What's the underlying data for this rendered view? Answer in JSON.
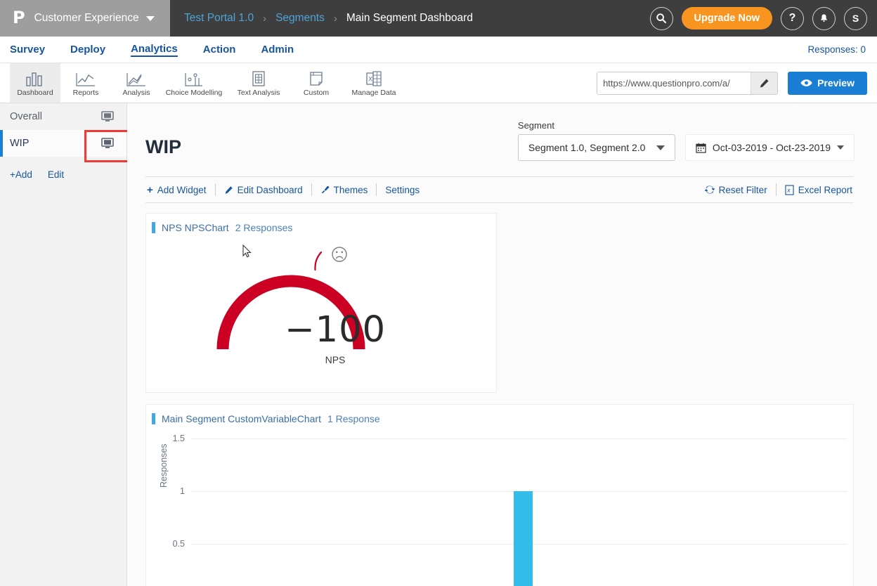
{
  "topbar": {
    "logo_glyph": "P",
    "brand_name": "Customer Experience",
    "breadcrumbs": [
      {
        "label": "Test Portal 1.0",
        "current": false
      },
      {
        "label": "Segments",
        "current": false
      },
      {
        "label": "Main Segment Dashboard",
        "current": true
      }
    ],
    "separator": "›",
    "search_icon": "⌕",
    "upgrade_label": "Upgrade Now",
    "help_icon": "?",
    "bell_icon": "▲",
    "avatar_label": "S"
  },
  "nav": {
    "tabs": [
      {
        "label": "Survey",
        "active": false
      },
      {
        "label": "Deploy",
        "active": false
      },
      {
        "label": "Analytics",
        "active": true
      },
      {
        "label": "Action",
        "active": false
      },
      {
        "label": "Admin",
        "active": false
      }
    ],
    "responses": "Responses: 0"
  },
  "icontoolbar": {
    "items": [
      {
        "label": "Dashboard",
        "icon": "bar-chart-icon",
        "active": true
      },
      {
        "label": "Reports",
        "icon": "line-chart-icon",
        "active": false
      },
      {
        "label": "Analysis",
        "icon": "trend-chart-icon",
        "active": false
      },
      {
        "label": "Choice Modelling",
        "icon": "scatter-chart-icon",
        "active": false
      },
      {
        "label": "Text Analysis",
        "icon": "document-grid-icon",
        "active": false
      },
      {
        "label": "Custom",
        "icon": "page-corner-icon",
        "active": false
      },
      {
        "label": "Manage Data",
        "icon": "excel-icon",
        "active": false
      }
    ],
    "url_value": "https://www.questionpro.com/a/",
    "url_placeholder": "https://www.questionpro.com/a/",
    "edit_icon": "✎",
    "preview_label": "Preview",
    "preview_icon": "eye-icon"
  },
  "sidebar": {
    "items": [
      {
        "label": "Overall",
        "icon": "monitor-icon",
        "selected": false
      },
      {
        "label": "WIP",
        "icon": "monitor-icon",
        "selected": true
      }
    ],
    "add_label": "+Add",
    "edit_label": "Edit",
    "highlight_color": "#ef3b36"
  },
  "main": {
    "page_title": "WIP",
    "segment_label": "Segment",
    "segment_value": "Segment 1.0, Segment 2.0",
    "date_value": "Oct-03-2019 - Oct-23-2019",
    "calendar_icon": "🗓",
    "toolbar": {
      "add_widget": "Add Widget",
      "edit_dashboard": "Edit Dashboard",
      "themes": "Themes",
      "settings": "Settings",
      "reset_filter": "Reset Filter",
      "excel_report": "Excel Report"
    }
  },
  "widgets": [
    {
      "title": "NPS NPSChart",
      "count": "2 Responses",
      "accent": "#41a8e0"
    },
    {
      "title": "Main Segment CustomVariableChart",
      "count": "1 Response",
      "accent": "#41a8e0"
    }
  ],
  "chart_data": [
    {
      "type": "gauge",
      "title": "NPS NPSChart",
      "value": -100,
      "display_value": "−100",
      "sublabel": "NPS",
      "min": -100,
      "max": 100,
      "arc_color": "#cc0022",
      "needle_color": "#cc0022",
      "face_icon": "sad-face-icon",
      "responses": 2
    },
    {
      "type": "bar",
      "title": "Main Segment CustomVariableChart",
      "ylabel": "Responses",
      "xlabel": "",
      "yticks": [
        "1.5",
        "1",
        "0.5"
      ],
      "ytick_values": [
        1.5,
        1,
        0.5
      ],
      "ylim": [
        0,
        1.6
      ],
      "categories": [
        ""
      ],
      "values": [
        1
      ],
      "bar_color": "#33bdeb",
      "grid": true,
      "responses": 1
    }
  ]
}
